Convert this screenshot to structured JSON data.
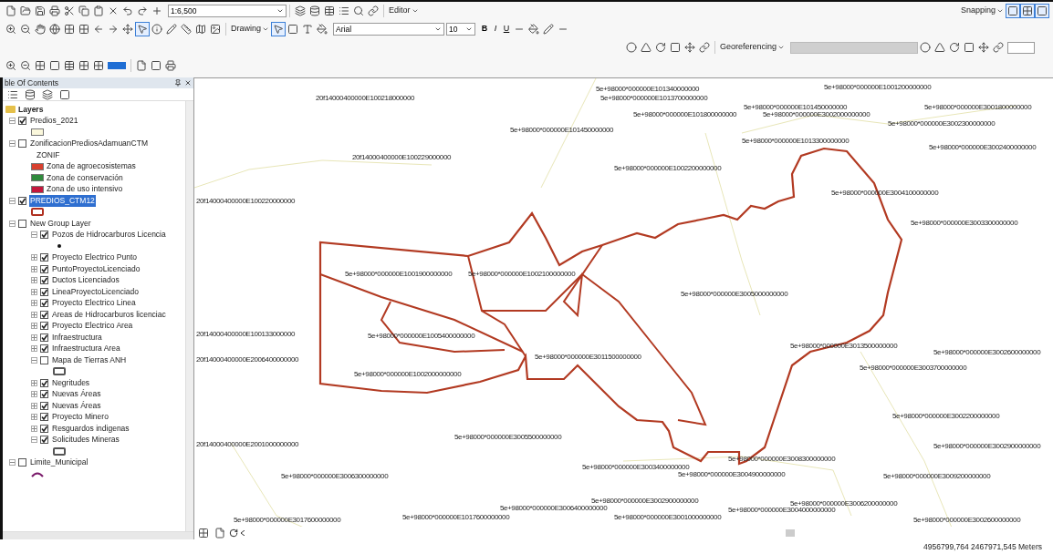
{
  "toolbar": {
    "scale": "1:6,500",
    "editor_menu": "Editor",
    "snapping_menu": "Snapping",
    "drawing_menu": "Drawing",
    "font": "Arial",
    "font_size": "10",
    "bold": "B",
    "italic": "I",
    "underline": "U",
    "georeferencing_menu": "Georeferencing"
  },
  "toc": {
    "title": "ble Of Contents",
    "root": "Layers",
    "items": [
      {
        "name": "Predios_2021",
        "checked": true,
        "expanded": true,
        "selected": false,
        "legend": [
          {
            "kind": "fill",
            "color": "#fbf8dc"
          }
        ]
      },
      {
        "name": "ZonificacionPrediosAdamuanCTM",
        "field": "ZONIF",
        "checked": false,
        "expanded": true,
        "selected": false,
        "legend": [
          {
            "kind": "fill",
            "color": "#d8402e",
            "label": "Zona de agroecosistemas"
          },
          {
            "kind": "fill",
            "color": "#2f8a3c",
            "label": "Zona de conservación"
          },
          {
            "kind": "fill",
            "color": "#c4173d",
            "label": "Zona de uso intensivo"
          }
        ]
      },
      {
        "name": "PREDIOS_CTM12",
        "checked": true,
        "expanded": true,
        "selected": true,
        "legend": [
          {
            "kind": "outline",
            "color": "#b03020"
          }
        ]
      },
      {
        "name": "New Group Layer",
        "checked": false,
        "expanded": true,
        "selected": false,
        "children": [
          {
            "name": "Pozos de Hidrocarburos Licencia",
            "checked": true,
            "expanded": true,
            "selected": false,
            "legend": [
              {
                "kind": "point",
                "color": "#111111"
              }
            ]
          },
          {
            "name": "Proyecto Electrico Punto",
            "checked": true,
            "expanded": false,
            "selected": false
          },
          {
            "name": "PuntoProyectoLicenciado",
            "checked": true,
            "expanded": false,
            "selected": false
          },
          {
            "name": "Ductos Licenciados",
            "checked": true,
            "expanded": false,
            "selected": false
          },
          {
            "name": "LineaProyectoLicenciado",
            "checked": true,
            "expanded": false,
            "selected": false
          },
          {
            "name": "Proyecto Electrico Linea",
            "checked": true,
            "expanded": false,
            "selected": false
          },
          {
            "name": "Areas de Hidrocarburos licenciac",
            "checked": true,
            "expanded": false,
            "selected": false
          },
          {
            "name": "Proyecto Electrico Area",
            "checked": true,
            "expanded": false,
            "selected": false
          },
          {
            "name": "Infraestructura",
            "checked": true,
            "expanded": false,
            "selected": false
          },
          {
            "name": "Infraestructura Area",
            "checked": true,
            "expanded": false,
            "selected": false
          },
          {
            "name": "Mapa de Tierras ANH",
            "checked": false,
            "expanded": true,
            "selected": false,
            "legend": [
              {
                "kind": "outline",
                "color": "#555555"
              }
            ]
          },
          {
            "name": "Negritudes",
            "checked": true,
            "expanded": false,
            "selected": false
          },
          {
            "name": "Nuevas Áreas",
            "checked": true,
            "expanded": false,
            "selected": false
          },
          {
            "name": "Nuevas Áreas",
            "checked": true,
            "expanded": false,
            "selected": false
          },
          {
            "name": "Proyecto Minero",
            "checked": true,
            "expanded": false,
            "selected": false
          },
          {
            "name": "Resguardos indigenas",
            "checked": true,
            "expanded": false,
            "selected": false
          },
          {
            "name": "Solicitudes Mineras",
            "checked": true,
            "expanded": true,
            "selected": false,
            "legend": [
              {
                "kind": "outline",
                "color": "#555555"
              }
            ]
          }
        ]
      },
      {
        "name": "Limite_Municipal",
        "checked": false,
        "expanded": true,
        "selected": false,
        "legend": [
          {
            "kind": "line",
            "color": "#7a1a6a"
          }
        ]
      }
    ]
  },
  "map_labels": [
    "20f14000400000E100218000000",
    "20f14000400000E100229000000",
    "20f14000400000E100220000000",
    "20f14000400000E100133000000",
    "20f14000400000E2006400000000",
    "20f14000400000E2001000000000",
    "5e+98000*000000E101340000000",
    "5e+98000*000000E1001200000000",
    "5e+98000*000000E1013700000000",
    "5e+98000*000000E101450000000",
    "5e+98000*000000E101800000000",
    "5e+98000*000000E3002000000000",
    "5e+98000*000000E101450000000",
    "5e+98000*000000E1013300000000",
    "5e+98000*000000E1002200000000",
    "5e+98000*000000E3001800000000",
    "5e+98000*000000E3002300000000",
    "5e+98000*000000E3002400000000",
    "5e+98000*000000E3004100000000",
    "5e+98000*000000E3003300000000",
    "5e+98000*000000E1001900000000",
    "5e+98000*000000E1002100000000",
    "5e+98000*000000E3005000000000",
    "5e+98000*000000E1005400000000",
    "5e+98000*000000E3011500000000",
    "5e+98000*000000E1002000000000",
    "5e+98000*000000E3013500000000",
    "5e+98000*000000E3002600000000",
    "5e+98000*000000E3003700000000",
    "5e+98000*000000E3002200000000",
    "5e+98000*000000E3005500000000",
    "5e+98000*000000E3006300000000",
    "5e+98000*000000E3003400000000",
    "5e+98000*000000E3004900000000",
    "5e+98000*000000E3008300000000",
    "5e+98000*000000E3009200000000",
    "5e+98000*000000E3002900000000",
    "5e+98000*000000E3002900000000",
    "5e+98000*000000E3006400000000",
    "5e+98000*000000E1017600000000",
    "5e+98000*000000E3017600000000",
    "5e+98000*000000E3001000000000",
    "5e+98000*000000E3004000000000",
    "5e+98000*000000E3006200000000",
    "5e+98000*000000E3002600000000"
  ],
  "status_bar": {
    "coordinates": "4956799,764 2467971,545 Meters"
  }
}
